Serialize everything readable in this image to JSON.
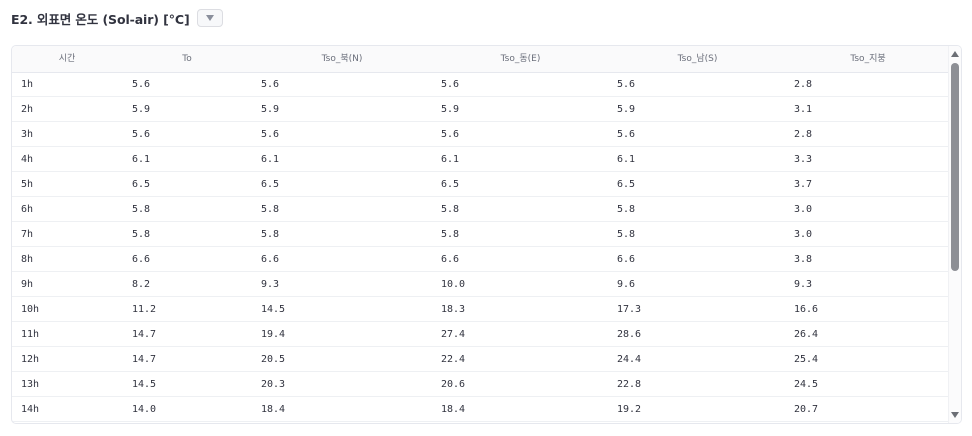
{
  "section": {
    "title": "E2. 외표면 온도 (Sol-air) [°C]",
    "toggle_icon": "caret-down-icon"
  },
  "table": {
    "columns": [
      "시간",
      "To",
      "Tso_북(N)",
      "Tso_동(E)",
      "Tso_남(S)",
      "Tso_지붕"
    ],
    "rows": [
      [
        "1h",
        "5.6",
        "5.6",
        "5.6",
        "5.6",
        "2.8"
      ],
      [
        "2h",
        "5.9",
        "5.9",
        "5.9",
        "5.9",
        "3.1"
      ],
      [
        "3h",
        "5.6",
        "5.6",
        "5.6",
        "5.6",
        "2.8"
      ],
      [
        "4h",
        "6.1",
        "6.1",
        "6.1",
        "6.1",
        "3.3"
      ],
      [
        "5h",
        "6.5",
        "6.5",
        "6.5",
        "6.5",
        "3.7"
      ],
      [
        "6h",
        "5.8",
        "5.8",
        "5.8",
        "5.8",
        "3.0"
      ],
      [
        "7h",
        "5.8",
        "5.8",
        "5.8",
        "5.8",
        "3.0"
      ],
      [
        "8h",
        "6.6",
        "6.6",
        "6.6",
        "6.6",
        "3.8"
      ],
      [
        "9h",
        "8.2",
        "9.3",
        "10.0",
        "9.6",
        "9.3"
      ],
      [
        "10h",
        "11.2",
        "14.5",
        "18.3",
        "17.3",
        "16.6"
      ],
      [
        "11h",
        "14.7",
        "19.4",
        "27.4",
        "28.6",
        "26.4"
      ],
      [
        "12h",
        "14.7",
        "20.5",
        "22.4",
        "24.4",
        "25.4"
      ],
      [
        "13h",
        "14.5",
        "20.3",
        "20.6",
        "22.8",
        "24.5"
      ],
      [
        "14h",
        "14.0",
        "18.4",
        "18.4",
        "19.2",
        "20.7"
      ]
    ]
  },
  "scrollbar": {
    "up_icon": "scroll-up-arrow-icon",
    "down_icon": "scroll-down-arrow-icon"
  }
}
